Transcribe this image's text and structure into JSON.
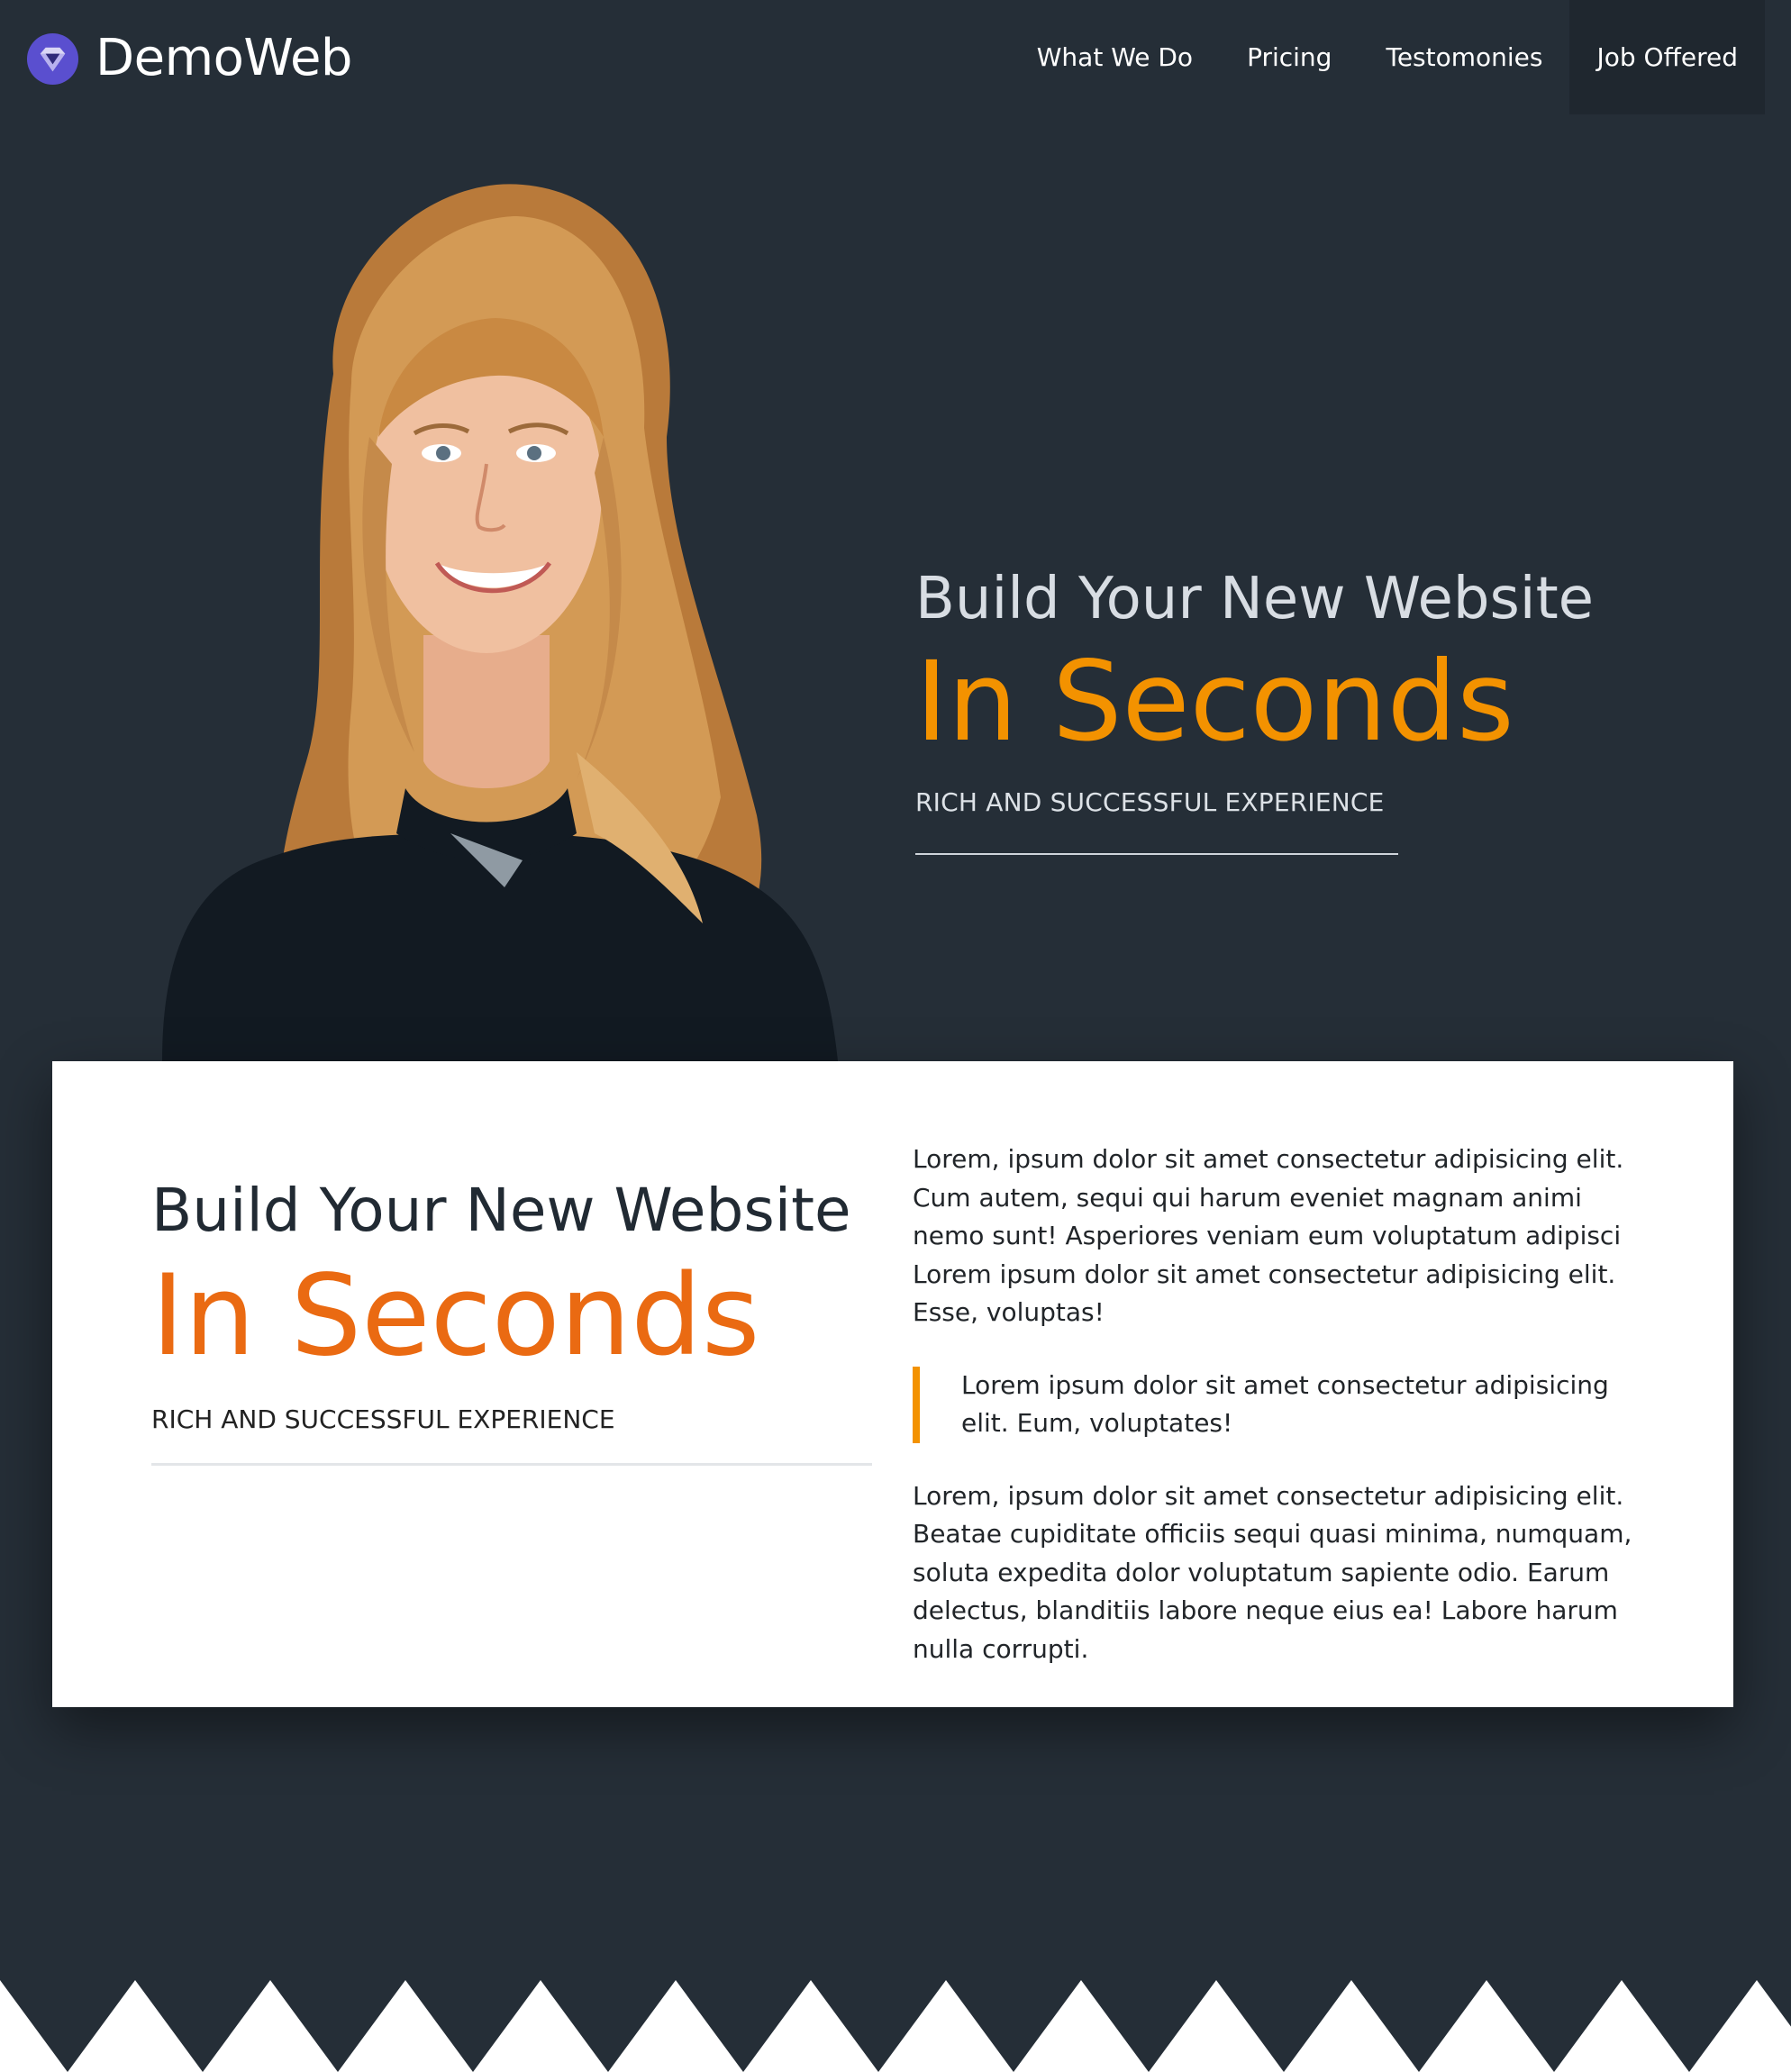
{
  "brand": {
    "name": "DemoWeb",
    "logo_icon": "diamond-logo-icon",
    "logo_color": "#5a4fcf"
  },
  "nav": {
    "items": [
      {
        "label": "What We Do",
        "active": false
      },
      {
        "label": "Pricing",
        "active": false
      },
      {
        "label": "Testomonies",
        "active": false
      },
      {
        "label": "Job Offered",
        "active": true
      }
    ]
  },
  "hero": {
    "title": "Build Your New Website",
    "accent": "In Seconds",
    "subtitle": "RICH AND SUCCESSFUL EXPERIENCE",
    "accent_color": "#f39200"
  },
  "card": {
    "title": "Build Your New Website",
    "accent": "In Seconds",
    "subtitle": "RICH AND SUCCESSFUL EXPERIENCE",
    "accent_color": "#ea6a12",
    "paragraph1": "Lorem, ipsum dolor sit amet consectetur adipisicing elit. Cum autem, sequi qui harum eveniet magnam animi nemo sunt! Asperiores veniam eum voluptatum adipisci Lorem ipsum dolor sit amet consectetur adipisicing elit. Esse, voluptas!",
    "quote": "Lorem ipsum dolor sit amet consectetur adipisicing elit. Eum, voluptates!",
    "paragraph2": "Lorem, ipsum dolor sit amet consectetur adipisicing elit. Beatae cupiditate officiis sequi quasi minima, numquam, soluta expedita dolor voluptatum sapiente odio. Earum delectus, blanditiis labore neque eius ea! Labore harum nulla corrupti."
  },
  "colors": {
    "background": "#252e37",
    "card_background": "#ffffff"
  }
}
